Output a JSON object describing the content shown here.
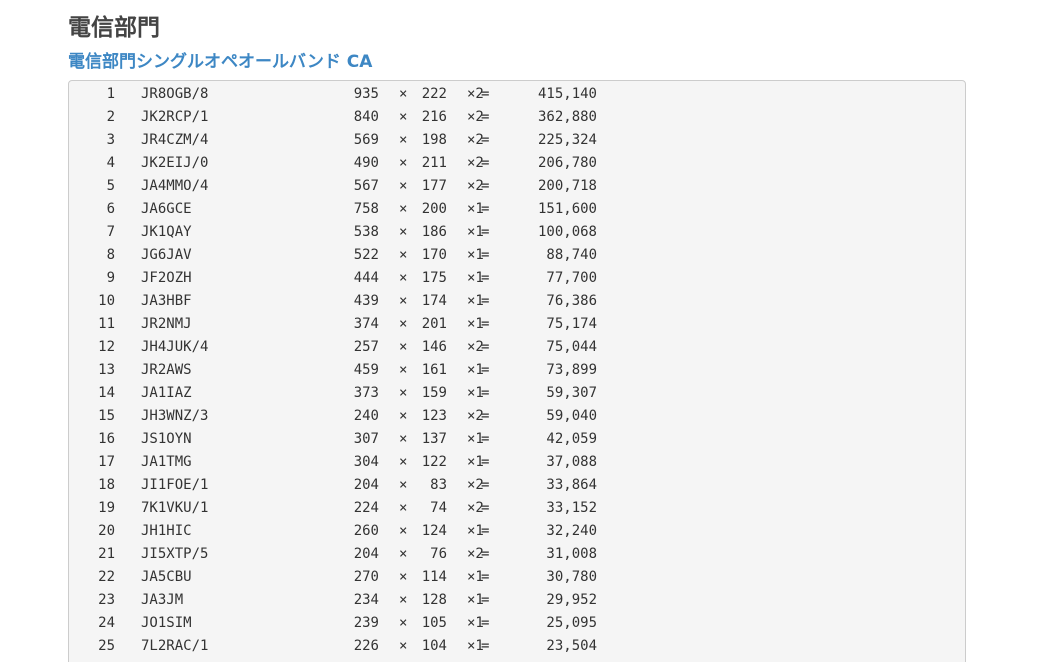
{
  "header": {
    "title": "電信部門",
    "subtitle": "電信部門シングルオペオールバンド CA"
  },
  "symbols": {
    "times": "×",
    "equals": "="
  },
  "results": [
    {
      "rank": "1",
      "call": "JR8OGB/8",
      "qso": "935",
      "mult": "222",
      "factor": "×2",
      "score": "415,140"
    },
    {
      "rank": "2",
      "call": "JK2RCP/1",
      "qso": "840",
      "mult": "216",
      "factor": "×2",
      "score": "362,880"
    },
    {
      "rank": "3",
      "call": "JR4CZM/4",
      "qso": "569",
      "mult": "198",
      "factor": "×2",
      "score": "225,324"
    },
    {
      "rank": "4",
      "call": "JK2EIJ/0",
      "qso": "490",
      "mult": "211",
      "factor": "×2",
      "score": "206,780"
    },
    {
      "rank": "5",
      "call": "JA4MMO/4",
      "qso": "567",
      "mult": "177",
      "factor": "×2",
      "score": "200,718"
    },
    {
      "rank": "6",
      "call": "JA6GCE",
      "qso": "758",
      "mult": "200",
      "factor": "×1",
      "score": "151,600"
    },
    {
      "rank": "7",
      "call": "JK1QAY",
      "qso": "538",
      "mult": "186",
      "factor": "×1",
      "score": "100,068"
    },
    {
      "rank": "8",
      "call": "JG6JAV",
      "qso": "522",
      "mult": "170",
      "factor": "×1",
      "score": "88,740"
    },
    {
      "rank": "9",
      "call": "JF2OZH",
      "qso": "444",
      "mult": "175",
      "factor": "×1",
      "score": "77,700"
    },
    {
      "rank": "10",
      "call": "JA3HBF",
      "qso": "439",
      "mult": "174",
      "factor": "×1",
      "score": "76,386"
    },
    {
      "rank": "11",
      "call": "JR2NMJ",
      "qso": "374",
      "mult": "201",
      "factor": "×1",
      "score": "75,174"
    },
    {
      "rank": "12",
      "call": "JH4JUK/4",
      "qso": "257",
      "mult": "146",
      "factor": "×2",
      "score": "75,044"
    },
    {
      "rank": "13",
      "call": "JR2AWS",
      "qso": "459",
      "mult": "161",
      "factor": "×1",
      "score": "73,899"
    },
    {
      "rank": "14",
      "call": "JA1IAZ",
      "qso": "373",
      "mult": "159",
      "factor": "×1",
      "score": "59,307"
    },
    {
      "rank": "15",
      "call": "JH3WNZ/3",
      "qso": "240",
      "mult": "123",
      "factor": "×2",
      "score": "59,040"
    },
    {
      "rank": "16",
      "call": "JS1OYN",
      "qso": "307",
      "mult": "137",
      "factor": "×1",
      "score": "42,059"
    },
    {
      "rank": "17",
      "call": "JA1TMG",
      "qso": "304",
      "mult": "122",
      "factor": "×1",
      "score": "37,088"
    },
    {
      "rank": "18",
      "call": "JI1FOE/1",
      "qso": "204",
      "mult": "83",
      "factor": "×2",
      "score": "33,864"
    },
    {
      "rank": "19",
      "call": "7K1VKU/1",
      "qso": "224",
      "mult": "74",
      "factor": "×2",
      "score": "33,152"
    },
    {
      "rank": "20",
      "call": "JH1HIC",
      "qso": "260",
      "mult": "124",
      "factor": "×1",
      "score": "32,240"
    },
    {
      "rank": "21",
      "call": "JI5XTP/5",
      "qso": "204",
      "mult": "76",
      "factor": "×2",
      "score": "31,008"
    },
    {
      "rank": "22",
      "call": "JA5CBU",
      "qso": "270",
      "mult": "114",
      "factor": "×1",
      "score": "30,780"
    },
    {
      "rank": "23",
      "call": "JA3JM",
      "qso": "234",
      "mult": "128",
      "factor": "×1",
      "score": "29,952"
    },
    {
      "rank": "24",
      "call": "JO1SIM",
      "qso": "239",
      "mult": "105",
      "factor": "×1",
      "score": "25,095"
    },
    {
      "rank": "25",
      "call": "7L2RAC/1",
      "qso": "226",
      "mult": "104",
      "factor": "×1",
      "score": "23,504"
    }
  ]
}
